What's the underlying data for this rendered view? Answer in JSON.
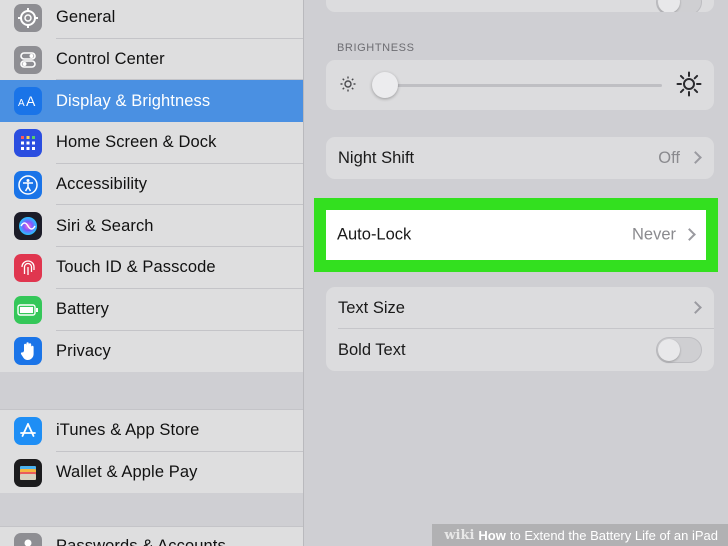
{
  "sidebar": {
    "groups": [
      {
        "items": [
          {
            "label": "General",
            "icon": "gear-icon",
            "color": "#8e8e93"
          },
          {
            "label": "Control Center",
            "icon": "toggles-icon",
            "color": "#8e8e93"
          },
          {
            "label": "Display & Brightness",
            "icon": "text-size-icon",
            "color": "#1a74e8",
            "selected": true
          },
          {
            "label": "Home Screen & Dock",
            "icon": "app-grid-icon",
            "color": "#2b4ee0"
          },
          {
            "label": "Accessibility",
            "icon": "accessibility-icon",
            "color": "#1a74e8"
          },
          {
            "label": "Siri & Search",
            "icon": "siri-icon",
            "color": "#2a2a3a"
          },
          {
            "label": "Touch ID & Passcode",
            "icon": "fingerprint-icon",
            "color": "#e0364f"
          },
          {
            "label": "Battery",
            "icon": "battery-icon",
            "color": "#34c759"
          },
          {
            "label": "Privacy",
            "icon": "hand-icon",
            "color": "#1a74e8"
          }
        ]
      },
      {
        "items": [
          {
            "label": "iTunes & App Store",
            "icon": "app-store-icon",
            "color": "#1e8ef5"
          },
          {
            "label": "Wallet & Apple Pay",
            "icon": "wallet-icon",
            "color": "#1c1c1e"
          }
        ]
      },
      {
        "items": [
          {
            "label": "Passwords & Accounts",
            "icon": "key-icon",
            "color": "#8e8e93"
          }
        ]
      }
    ]
  },
  "main": {
    "brightness_label": "BRIGHTNESS",
    "brightness_level": 0.03,
    "night_shift": {
      "title": "Night Shift",
      "value": "Off"
    },
    "auto_lock": {
      "title": "Auto-Lock",
      "value": "Never"
    },
    "text_size": {
      "title": "Text Size"
    },
    "bold_text": {
      "title": "Bold Text",
      "on": false
    },
    "highlight_color": "#33e01f"
  },
  "watermark": {
    "wiki": "wiki",
    "how": "How",
    "rest": "to Extend the Battery Life of an iPad"
  }
}
